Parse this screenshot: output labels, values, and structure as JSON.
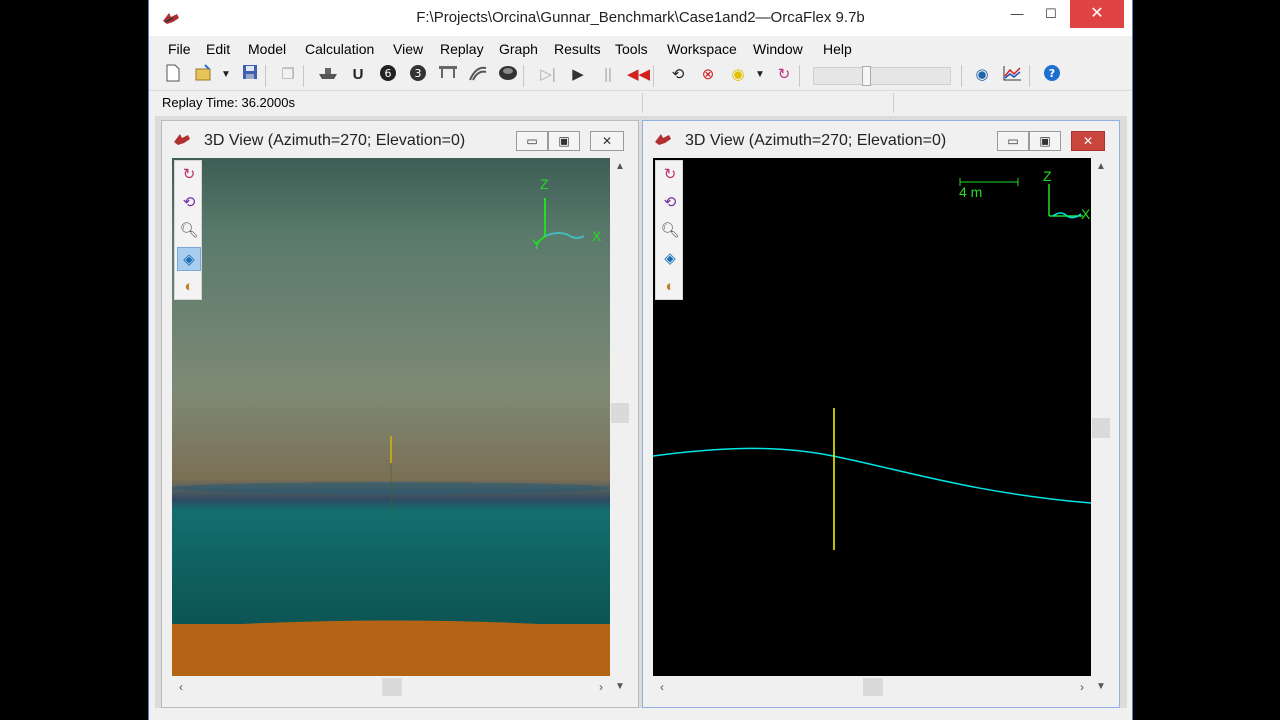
{
  "window": {
    "title": "F:\\Projects\\Orcina\\Gunnar_Benchmark\\Case1and2—OrcaFlex 9.7b",
    "minimize": "—",
    "maximize": "☐",
    "close": "✕"
  },
  "menu": [
    "File",
    "Edit",
    "Model",
    "Calculation",
    "View",
    "Replay",
    "Graph",
    "Results",
    "Tools",
    "Workspace",
    "Window",
    "Help"
  ],
  "status": {
    "replay_time": "Replay Time: 36.2000s"
  },
  "toolbar": {
    "icons": [
      "new-icon",
      "open-icon",
      "save-icon",
      "copy-icon",
      "vessel-icon",
      "line-icon",
      "winch-6d-icon",
      "winch-3d-icon",
      "link-icon",
      "shape-icon",
      "buoy-icon",
      "replay-start-icon",
      "play-icon",
      "pause-icon",
      "rewind-icon",
      "reset-icon",
      "stop-icon",
      "pause-calc-icon",
      "cycle-icon",
      "eye-icon",
      "graph-icon",
      "help-icon"
    ],
    "replay_slider": 0.38
  },
  "views": [
    {
      "title": "3D View (Azimuth=270; Elevation=0)",
      "mode": "shaded",
      "axes": {
        "z": "Z",
        "x": "X",
        "y": "Y"
      }
    },
    {
      "title": "3D View (Azimuth=270; Elevation=0)",
      "mode": "wireframe",
      "scale": "4 m",
      "axes": {
        "z": "Z",
        "x": "X"
      }
    }
  ],
  "colors": {
    "title_close": "#e04343",
    "wave_line": "#00e5e5",
    "riser_line": "#ffff00",
    "axis_green": "#22dd22",
    "seabed": "#b46414"
  }
}
